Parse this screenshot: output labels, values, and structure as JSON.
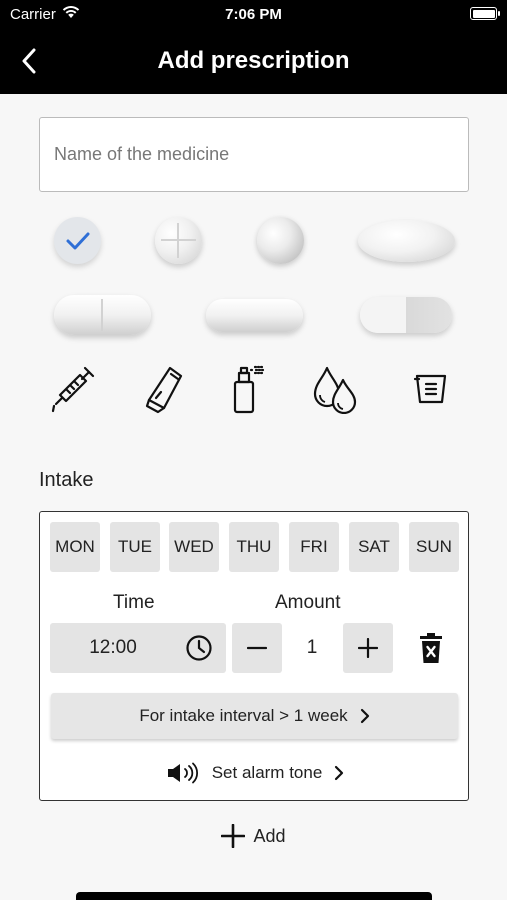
{
  "status_bar": {
    "carrier": "Carrier",
    "time": "7:06 PM"
  },
  "navbar": {
    "title": "Add prescription"
  },
  "name_field": {
    "placeholder": "Name of the medicine",
    "value": ""
  },
  "form_selector": {
    "selected": "check",
    "items": [
      "check",
      "scored-round-tablet",
      "gel-sphere",
      "oval-tablet",
      "scored-caplet",
      "long-softgel",
      "capsule",
      "syringe-icon",
      "ointment-tube-icon",
      "spray-icon",
      "drops-icon",
      "measuring-cup-icon"
    ]
  },
  "intake": {
    "label": "Intake",
    "days": [
      "MON",
      "TUE",
      "WED",
      "THU",
      "FRI",
      "SAT",
      "SUN"
    ],
    "time_label": "Time",
    "amount_label": "Amount",
    "time_value": "12:00",
    "amount_value": "1",
    "interval_button": "For intake interval > 1 week",
    "alarm_label": "Set alarm tone"
  },
  "add_label": "Add",
  "colors": {
    "bar": "#000000",
    "background": "#f7f7f7",
    "button_gray": "#e4e4e4",
    "check_blue": "#2f6fd6"
  }
}
